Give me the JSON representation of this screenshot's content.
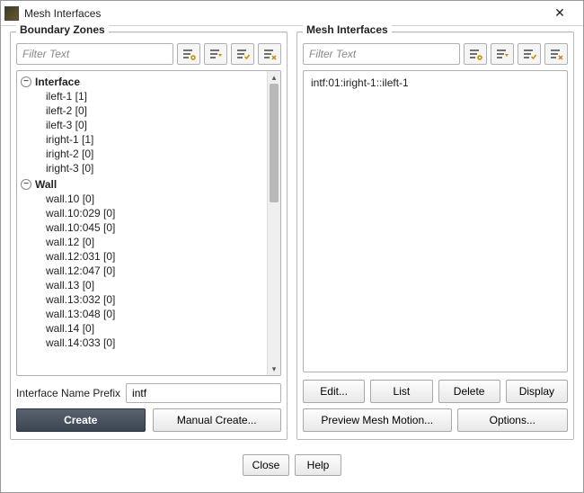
{
  "window": {
    "title": "Mesh Interfaces",
    "close_symbol": "✕"
  },
  "left": {
    "label": "Boundary Zones",
    "filter_placeholder": "Filter Text",
    "groups": [
      {
        "name": "Interface",
        "items": [
          "ileft-1  [1]",
          "ileft-2  [0]",
          "ileft-3  [0]",
          "iright-1  [1]",
          "iright-2  [0]",
          "iright-3  [0]"
        ]
      },
      {
        "name": "Wall",
        "items": [
          "wall.10  [0]",
          "wall.10:029  [0]",
          "wall.10:045  [0]",
          "wall.12  [0]",
          "wall.12:031  [0]",
          "wall.12:047  [0]",
          "wall.13  [0]",
          "wall.13:032  [0]",
          "wall.13:048  [0]",
          "wall.14  [0]",
          "wall.14:033  [0]"
        ]
      }
    ],
    "prefix_label": "Interface Name Prefix",
    "prefix_value": "intf",
    "create_label": "Create",
    "manual_create_label": "Manual Create..."
  },
  "right": {
    "label": "Mesh Interfaces",
    "filter_placeholder": "Filter Text",
    "items": [
      "intf:01:iright-1::ileft-1"
    ],
    "edit_label": "Edit...",
    "list_label": "List",
    "delete_label": "Delete",
    "display_label": "Display",
    "preview_label": "Preview Mesh Motion...",
    "options_label": "Options..."
  },
  "footer": {
    "close_label": "Close",
    "help_label": "Help"
  }
}
